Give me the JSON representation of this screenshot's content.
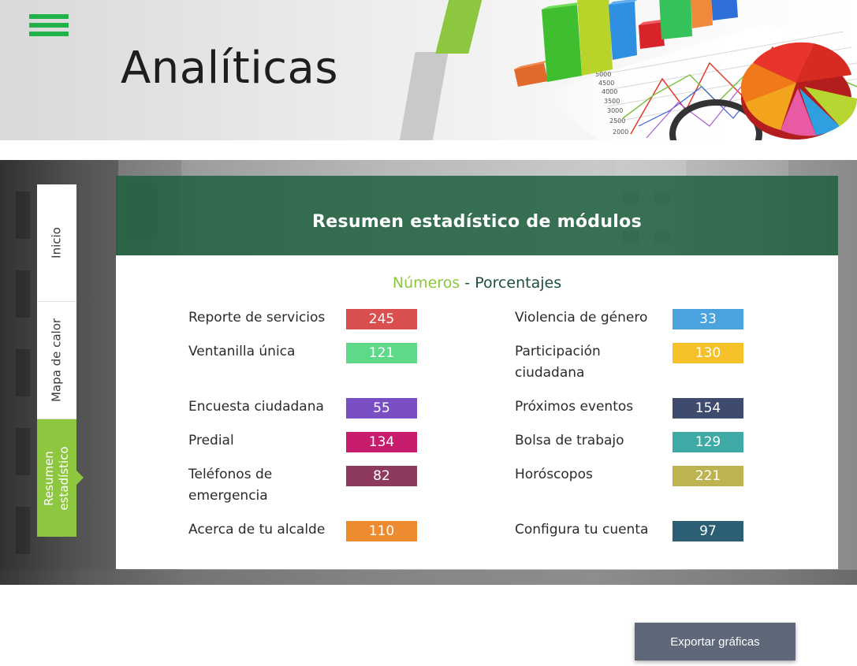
{
  "header": {
    "title": "Analíticas",
    "menu_icon": "hamburger-icon",
    "accent": "#22b24c",
    "chart_axis_labels": [
      "5000",
      "4500",
      "4000",
      "3500",
      "3000",
      "2500",
      "2000"
    ]
  },
  "side_nav": {
    "items": [
      {
        "label": "Inicio",
        "active": false
      },
      {
        "label": "Mapa de calor",
        "active": false
      },
      {
        "label": "Resumen estadístico",
        "active": true
      }
    ],
    "active_color": "#8dc63f"
  },
  "panel": {
    "title": "Resumen estadístico de módulos",
    "header_color": "#1d603e",
    "toggle": {
      "numbers": "Números",
      "separator": "-",
      "percentages": "Porcentajes",
      "selected": "Números"
    },
    "stats": [
      {
        "label": "Reporte de servicios",
        "value": "245",
        "color": "#d94f4f"
      },
      {
        "label": "Violencia de género",
        "value": "33",
        "color": "#4aa3df"
      },
      {
        "label": "Ventanilla única",
        "value": "121",
        "color": "#5ed98a"
      },
      {
        "label": "Participación ciudadana",
        "value": "130",
        "color": "#f5c02a"
      },
      {
        "label": "Encuesta ciudadana",
        "value": "55",
        "color": "#7b4fc4"
      },
      {
        "label": "Próximos eventos",
        "value": "154",
        "color": "#3e4a6e"
      },
      {
        "label": "Predial",
        "value": "134",
        "color": "#c71c6b"
      },
      {
        "label": "Bolsa de trabajo",
        "value": "129",
        "color": "#3fa9a5"
      },
      {
        "label": "Teléfonos de emergencia",
        "value": "82",
        "color": "#8e3a5e"
      },
      {
        "label": "Horóscopos",
        "value": "221",
        "color": "#bdb350"
      },
      {
        "label": "Acerca de tu alcalde",
        "value": "110",
        "color": "#ee8a2f"
      },
      {
        "label": "Configura tu cuenta",
        "value": "97",
        "color": "#2c5f73"
      }
    ]
  },
  "footer": {
    "export_label": "Exportar gráficas",
    "export_color": "#5e6878"
  }
}
